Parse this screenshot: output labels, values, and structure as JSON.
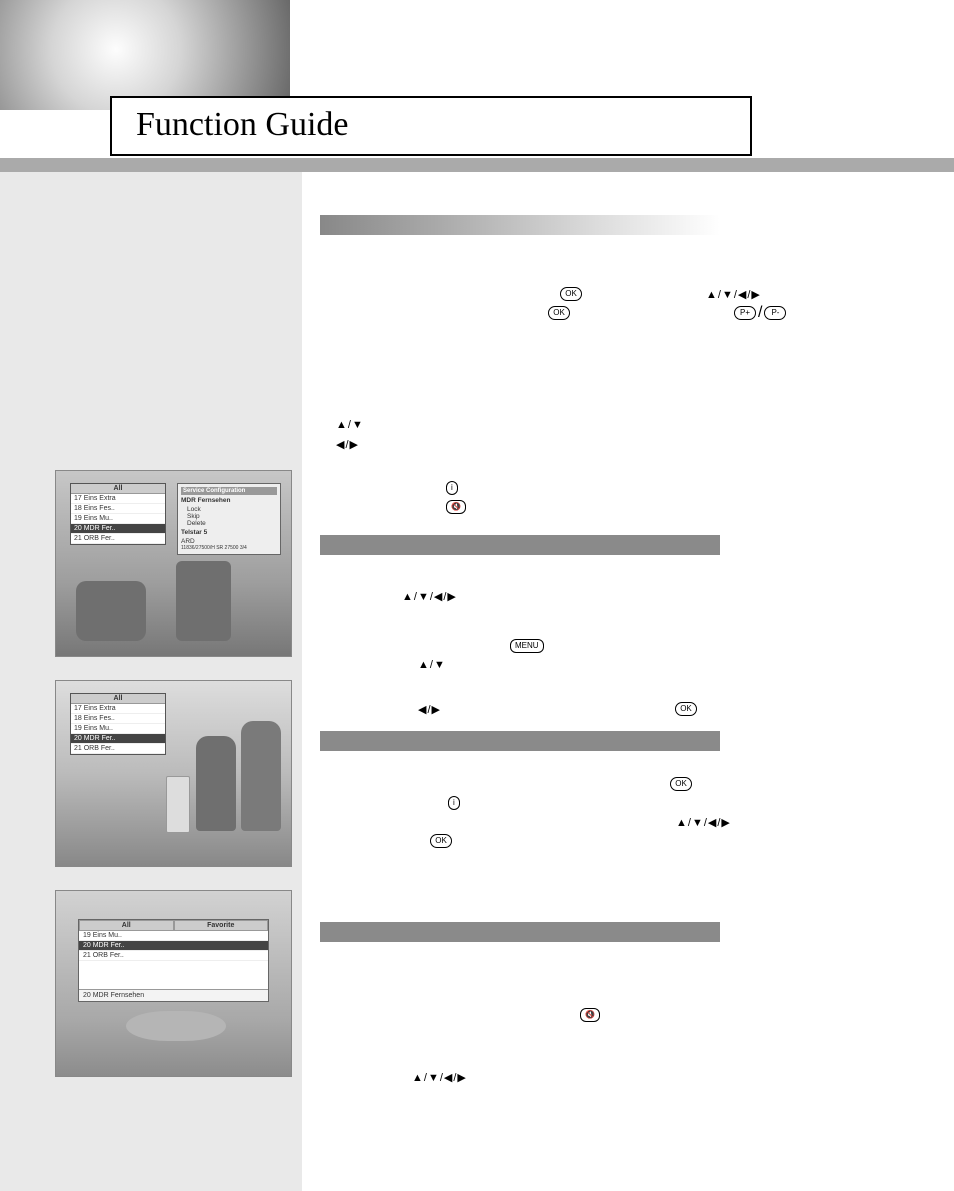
{
  "title": "Function Guide",
  "sections": [
    {
      "id": "sec1"
    },
    {
      "id": "sec2"
    },
    {
      "id": "sec3"
    },
    {
      "id": "sec4"
    }
  ],
  "icons": {
    "ok": "OK",
    "menu": "MENU",
    "info": "i",
    "mute": "🔇",
    "p_plus": "P+",
    "p_minus": "P-",
    "arrows_udlr": "▲/▼/◀/▶",
    "arrows_ud": "▲/▼",
    "arrows_lr": "◀/▶"
  },
  "screenshots": {
    "s1": {
      "list_header": "All",
      "rows": [
        "17 Eins Extra",
        "18 Eins Fes..",
        "19 Eins Mu..",
        "20 MDR Fer..",
        "21 ORB Fer.."
      ],
      "selected_index": 3,
      "popup": {
        "header": "Service Configuration",
        "title": "MDR Fernsehen",
        "items": [
          "Lock",
          "Skip",
          "Delete"
        ],
        "footer1": "Telstar 5",
        "footer2": "ARD",
        "footer3": "11836/27500/H  SR 27500  3/4"
      }
    },
    "s2": {
      "list_header": "All",
      "rows": [
        "17 Eins Extra",
        "18 Eins Fes..",
        "19 Eins Mu..",
        "20 MDR Fer..",
        "21 ORB Fer.."
      ],
      "selected_index": 3
    },
    "s3": {
      "header_left": "All",
      "header_right": "Favorite",
      "rows": [
        "19 Eins Mu..",
        "20 MDR Fer..",
        "21 ORB Fer.."
      ],
      "selected_index": 1,
      "footer": "20   MDR Fernsehen"
    }
  }
}
